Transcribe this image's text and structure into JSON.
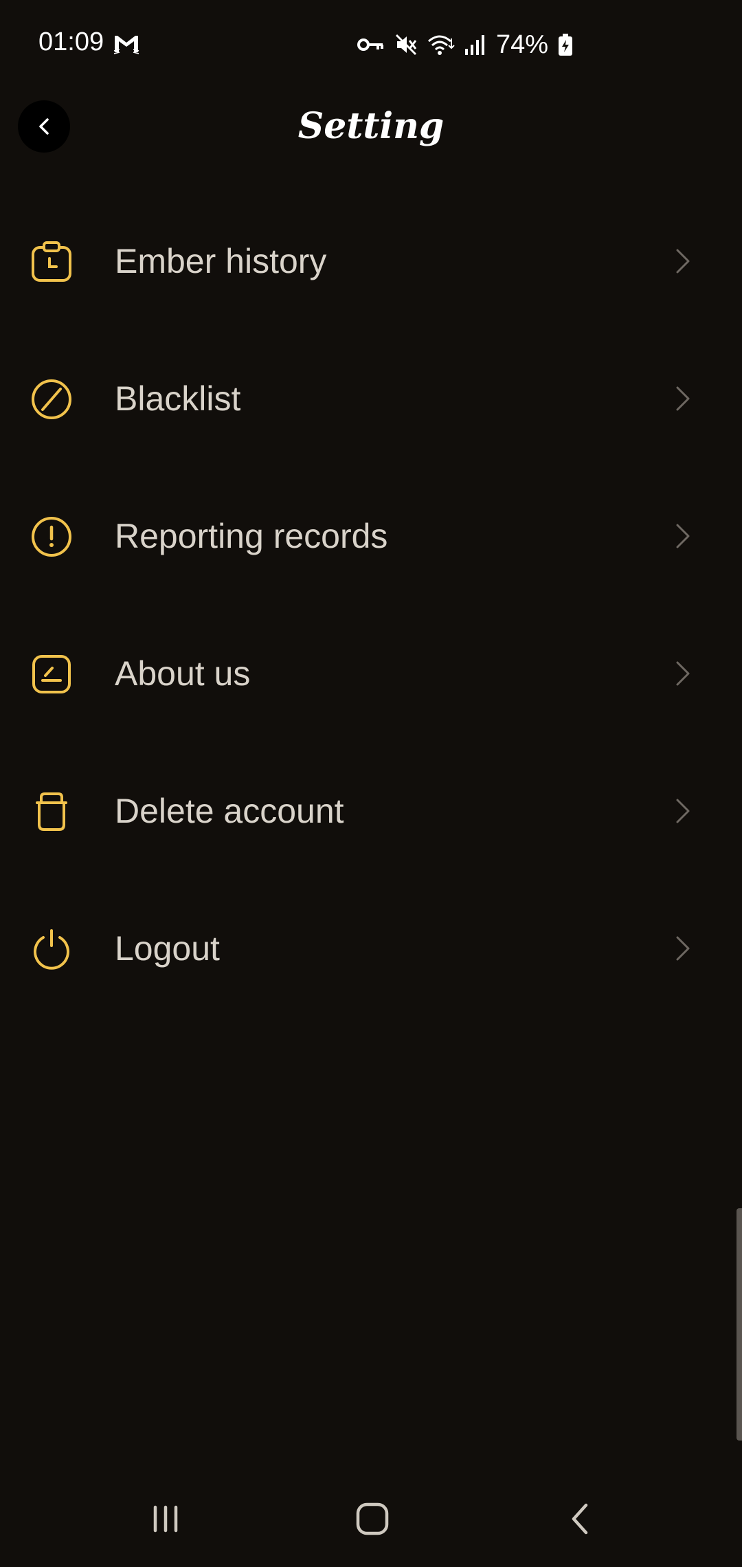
{
  "status_bar": {
    "time": "01:09",
    "battery_percent": "74%",
    "icons": [
      "gmail-icon",
      "vpn-key-icon",
      "mute-icon",
      "wifi-icon",
      "signal-icon",
      "battery-charging-icon"
    ]
  },
  "header": {
    "title": "Setting",
    "back_icon": "chevron-left-icon"
  },
  "menu": {
    "items": [
      {
        "label": "Ember history",
        "icon": "clock-clipboard-icon"
      },
      {
        "label": "Blacklist",
        "icon": "block-icon"
      },
      {
        "label": "Reporting records",
        "icon": "alert-circle-icon"
      },
      {
        "label": "About us",
        "icon": "info-card-icon"
      },
      {
        "label": "Delete account",
        "icon": "trash-icon"
      },
      {
        "label": "Logout",
        "icon": "power-icon"
      }
    ]
  },
  "nav_bar": {
    "buttons": [
      "recent-apps",
      "home",
      "back"
    ]
  },
  "colors": {
    "background": "#110e0b",
    "accent": "#f1c24c",
    "text": "#d9d3ca",
    "chevron": "#6e6862"
  }
}
